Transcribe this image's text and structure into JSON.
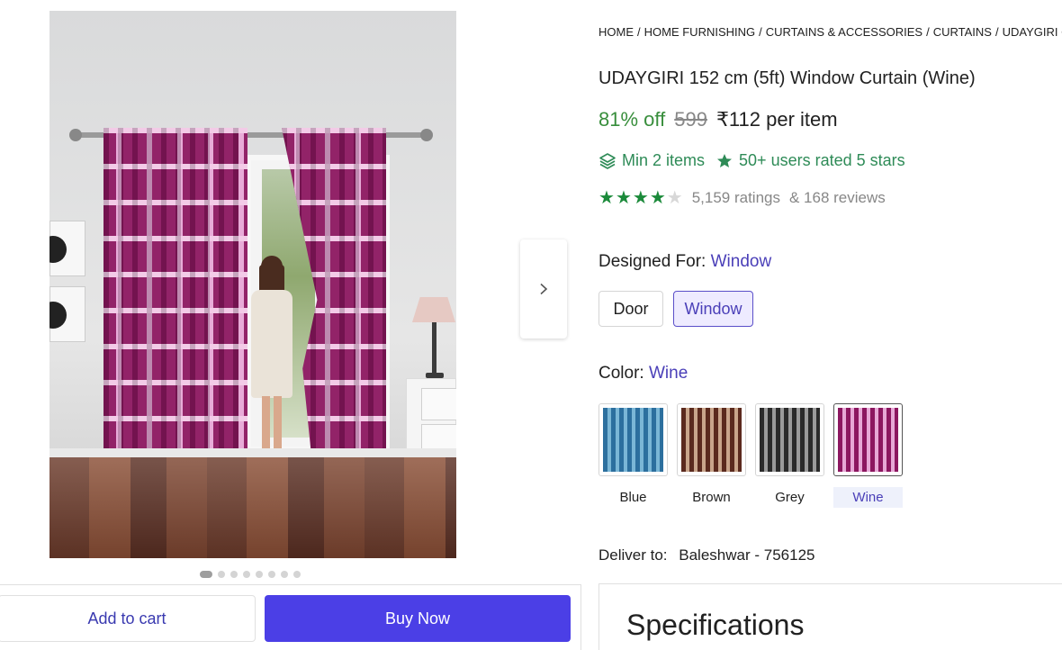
{
  "breadcrumb": {
    "items": [
      "HOME",
      "HOME FURNISHING",
      "CURTAINS & ACCESSORIES",
      "CURTAINS",
      "UDAYGIRI CUR"
    ]
  },
  "product": {
    "title": "UDAYGIRI 152 cm (5ft) Window Curtain (Wine)",
    "discount": "81% off",
    "mrp": "599",
    "price": "₹112 per item"
  },
  "offers": {
    "min_items": "Min 2 items",
    "users_rated": "50+ users rated 5 stars",
    "min_items_icon": "layers-icon",
    "users_rated_icon": "star-badge-icon"
  },
  "rating": {
    "stars": 4,
    "ratings_text": "5,159 ratings",
    "reviews_text": "& 168 reviews"
  },
  "designed_for": {
    "label": "Designed For:",
    "selected": "Window",
    "options": [
      "Door",
      "Window"
    ]
  },
  "color": {
    "label": "Color:",
    "selected": "Wine",
    "swatches": [
      "Blue",
      "Brown",
      "Grey",
      "Wine"
    ]
  },
  "delivery": {
    "label": "Deliver to:",
    "location": "Baleshwar - 756125"
  },
  "specifications": {
    "title": "Specifications"
  },
  "actions": {
    "add_to_cart": "Add to cart",
    "buy_now": "Buy Now"
  },
  "carousel": {
    "total_images": 8,
    "active_index": 0,
    "next_icon": "chevron-right-icon"
  },
  "colors": {
    "accent": "#4b3fe6",
    "green": "#388e3c",
    "link": "#4a3fb8"
  }
}
